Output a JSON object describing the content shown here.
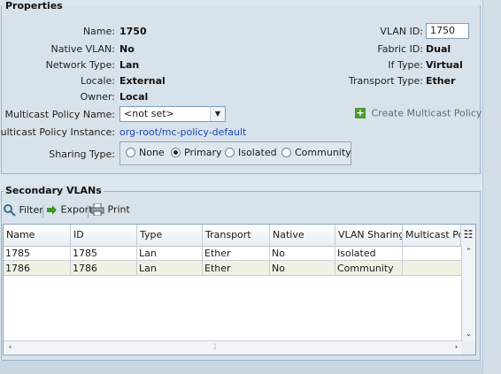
{
  "properties": {
    "legend": "Properties",
    "name_label": "Name:",
    "name_value": "1750",
    "native_vlan_label": "Native VLAN:",
    "native_vlan_value": "No",
    "network_type_label": "Network Type:",
    "network_type_value": "Lan",
    "locale_label": "Locale:",
    "locale_value": "External",
    "owner_label": "Owner:",
    "owner_value": "Local",
    "vlan_id_label": "VLAN ID:",
    "vlan_id_value": "1750",
    "fabric_id_label": "Fabric ID:",
    "fabric_id_value": "Dual",
    "if_type_label": "If Type:",
    "if_type_value": "Virtual",
    "transport_type_label": "Transport Type:",
    "transport_type_value": "Ether",
    "multicast_policy_name_label": "Multicast Policy Name:",
    "multicast_policy_name_value": "<not set>",
    "create_multicast_policy_label": "Create Multicast Policy",
    "multicast_policy_instance_label": "Multicast Policy Instance:",
    "multicast_policy_instance_value": "org-root/mc-policy-default",
    "sharing_type_label": "Sharing Type:",
    "sharing_options": [
      "None",
      "Primary",
      "Isolated",
      "Community"
    ],
    "sharing_selected": "Primary"
  },
  "secondary_vlans": {
    "legend": "Secondary VLANs",
    "toolbar": {
      "filter": "Filter",
      "export": "Export",
      "print": "Print"
    },
    "columns": [
      "Name",
      "ID",
      "Type",
      "Transport",
      "Native",
      "VLAN Sharing",
      "Multicast Poli"
    ],
    "rows": [
      [
        "1785",
        "1785",
        "Lan",
        "Ether",
        "No",
        "Isolated",
        ""
      ],
      [
        "1786",
        "1786",
        "Lan",
        "Ether",
        "No",
        "Community",
        ""
      ]
    ]
  },
  "icons": {
    "add": "plus-icon",
    "filter": "filter-icon",
    "export": "export-arrow-icon",
    "print": "printer-icon",
    "column_chooser": "column-chooser-icon"
  }
}
